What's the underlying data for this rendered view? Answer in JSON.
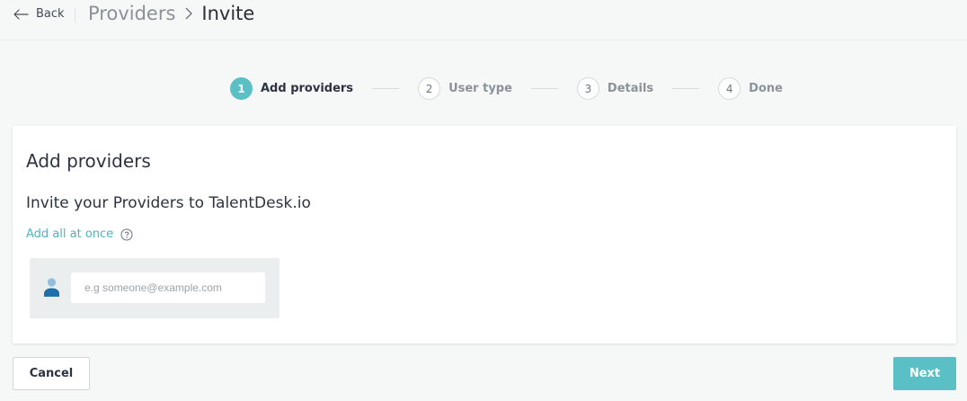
{
  "header": {
    "back_label": "Back",
    "breadcrumb_parent": "Providers",
    "breadcrumb_current": "Invite"
  },
  "stepper": {
    "steps": [
      {
        "number": "1",
        "label": "Add providers",
        "active": true
      },
      {
        "number": "2",
        "label": "User type",
        "active": false
      },
      {
        "number": "3",
        "label": "Details",
        "active": false
      },
      {
        "number": "4",
        "label": "Done",
        "active": false
      }
    ]
  },
  "card": {
    "title": "Add providers",
    "subtitle": "Invite your Providers to TalentDesk.io",
    "add_all_link": "Add all at once",
    "email_placeholder": "e.g someone@example.com",
    "email_value": ""
  },
  "footer": {
    "cancel_label": "Cancel",
    "next_label": "Next"
  },
  "colors": {
    "accent": "#5bc0c6",
    "link": "#4fb3bb",
    "person_icon": "#1f6fa8"
  },
  "icons": {
    "back": "arrow-left-icon",
    "breadcrumb_separator": "chevron-right-icon",
    "help": "question-circle-icon",
    "user": "person-icon"
  }
}
